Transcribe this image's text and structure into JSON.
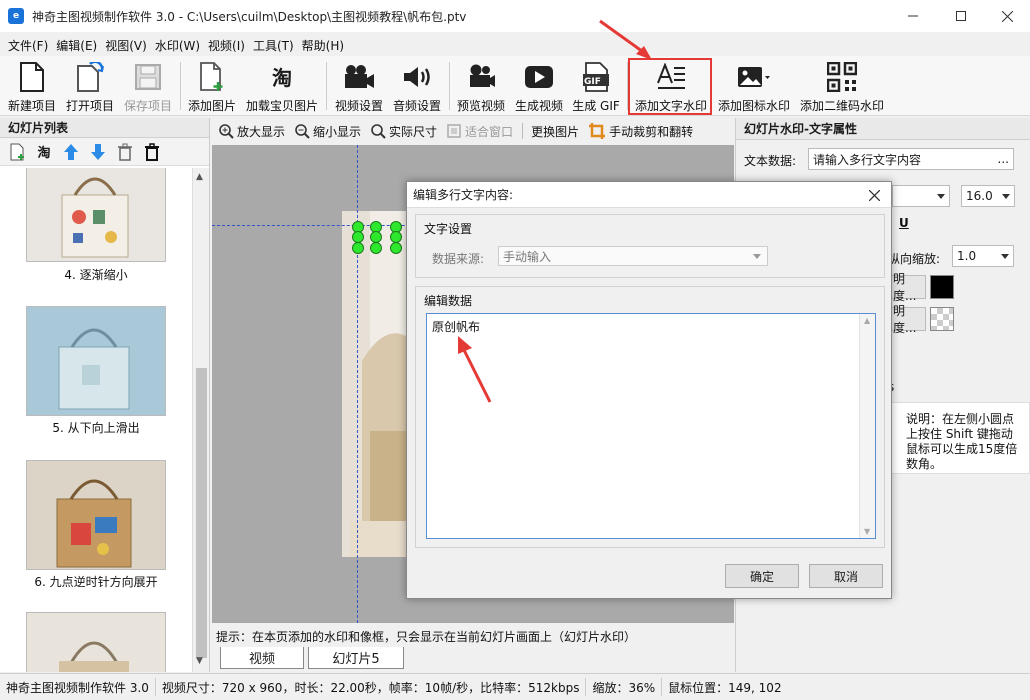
{
  "window": {
    "title": "神奇主图视频制作软件 3.0 - C:\\Users\\cuilm\\Desktop\\主图视频教程\\帆布包.ptv",
    "app_icon_text": "e"
  },
  "menu": [
    "文件(F)",
    "编辑(E)",
    "视图(V)",
    "水印(W)",
    "视频(I)",
    "工具(T)",
    "帮助(H)"
  ],
  "toolbar": {
    "new_project": "新建项目",
    "open_project": "打开项目",
    "save_project": "保存项目",
    "add_image": "添加图片",
    "load_taobao": "加载宝贝图片",
    "taobao_glyph": "淘",
    "video_settings": "视频设置",
    "audio_settings": "音频设置",
    "preview_video": "预览视频",
    "generate_video": "生成视频",
    "generate_gif": "生成 GIF",
    "gif_glyph": "GIF",
    "add_text_watermark": "添加文字水印",
    "add_icon_watermark": "添加图标水印",
    "add_qr_watermark": "添加二维码水印"
  },
  "slides_panel": {
    "title": "幻灯片列表",
    "taobao_glyph": "淘",
    "items": [
      {
        "label": "4. 逐渐缩小"
      },
      {
        "label": "5. 从下向上滑出"
      },
      {
        "label": "6. 九点逆时针方向展开"
      }
    ]
  },
  "canvas_toolbar": {
    "zoom_in": "放大显示",
    "zoom_out": "缩小显示",
    "actual_size": "实际尺寸",
    "fit_window": "适合窗口",
    "replace_image": "更换图片",
    "crop_flip": "手动裁剪和翻转"
  },
  "hint": "提示：在本页添加的水印和像框，只会显示在当前幻灯片画面上（幻灯片水印）",
  "tabs": {
    "video": "视频",
    "slide5": "幻灯片5"
  },
  "right_panel": {
    "title": "幻灯片水印-文字属性",
    "text_data_label": "文本数据:",
    "text_data_value": "请输入多行文字内容",
    "ellipsis": "...",
    "font_size": "16.0",
    "underline": "U",
    "v_scale_label": "纵向缩放:",
    "v_scale_value": "1.0",
    "opacity1": "明度...",
    "opacity2": "明度...",
    "fragment_s": "s",
    "note": "说明：在左侧小圆点上按住 Shift 键拖动鼠标可以生成15度倍数角。",
    "colors": {
      "swatch1": "#000000"
    }
  },
  "dialog": {
    "title": "编辑多行文字内容:",
    "group_text_settings": "文字设置",
    "data_source_label": "数据来源:",
    "data_source_value": "手动输入",
    "group_edit_data": "编辑数据",
    "text_value": "原创帆布",
    "ok": "确定",
    "cancel": "取消"
  },
  "status": {
    "app": "神奇主图视频制作软件 3.0",
    "video_info": "视频尺寸：720 x 960，时长：22.00秒，帧率：10帧/秒，比特率：512kbps",
    "zoom": "缩放：36%",
    "mouse": "鼠标位置：149, 102"
  }
}
